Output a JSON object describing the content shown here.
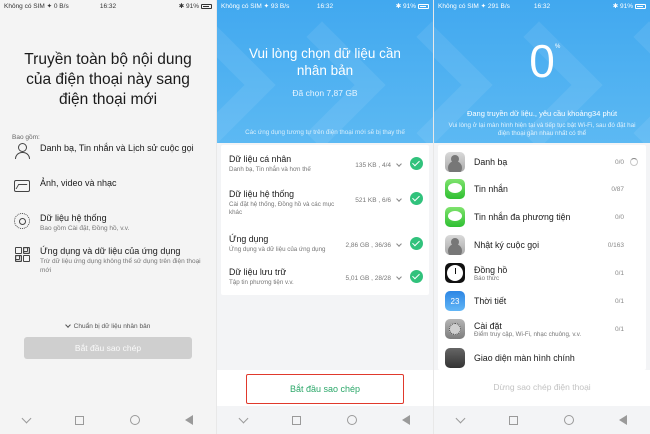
{
  "screen1": {
    "status": {
      "left": "Không có SIM ✦ 0 B/s",
      "time": "16:32",
      "right": "✱ 91%"
    },
    "title": "Truyền toàn bộ nội dung của điện thoại này sang điện thoại mới",
    "includes_label": "Bao gồm:",
    "options": [
      {
        "icon": "person-icon",
        "label": "Danh bạ, Tin nhắn và Lịch sử cuộc gọi",
        "sub": ""
      },
      {
        "icon": "photo-icon",
        "label": "Ảnh, video và nhạc",
        "sub": ""
      },
      {
        "icon": "gear-icon",
        "label": "Dữ liệu hệ thống",
        "sub": "Bao gồm Cài đặt, Đồng hồ, v.v."
      },
      {
        "icon": "apps-icon",
        "label": "Ứng dụng và dữ liệu của ứng dụng",
        "sub": "Trừ dữ liệu ứng dụng không thể sử dụng trên điện thoại mới"
      }
    ],
    "prepare_label": "Chuẩn bị dữ liệu nhân bản",
    "start_button": "Bắt đầu sao chép"
  },
  "screen2": {
    "status": {
      "left": "Không có SIM ✦ 93 B/s",
      "time": "16:32",
      "right": "✱ 91%"
    },
    "title": "Vui lòng chọn dữ liệu cần nhân bản",
    "selected": "Đã chọn 7,87 GB",
    "note": "Các ứng dụng tương tự trên điện thoại mới sẽ bị thay thế",
    "items": [
      {
        "name": "Dữ liệu cá nhân",
        "desc": "Danh bạ, Tin nhắn và hơn thế",
        "size": "135 KB , 4/4"
      },
      {
        "name": "Dữ liệu hệ thống",
        "desc": "Cài đặt hệ thống, Đồng hồ và các mục khác",
        "size": "521 KB , 6/6"
      },
      {
        "name": "Ứng dụng",
        "desc": "Ứng dụng và dữ liệu của ứng dụng",
        "size": "2,86 GB , 36/36"
      },
      {
        "name": "Dữ liệu lưu trữ",
        "desc": "Tập tin phương tiện v.v.",
        "size": "5,01 GB , 28/28"
      }
    ],
    "start_button": "Bắt đầu sao chép"
  },
  "screen3": {
    "status": {
      "left": "Không có SIM ✦ 291 B/s",
      "time": "16:32",
      "right": "✱ 91%"
    },
    "progress_value": "0",
    "progress_unit": "%",
    "message": "Đang truyền dữ liệu., yêu cầu khoảng34 phút",
    "note": "Vui lòng ở lại màn hình hiện tại và tiếp tục bật Wi-Fi, sau đó đặt hai điện thoại gần nhau nhất có thể",
    "items": [
      {
        "icon": "contacts-icon",
        "name": "Danh bạ",
        "desc": "",
        "count": "0/0"
      },
      {
        "icon": "messages-icon",
        "name": "Tin nhắn",
        "desc": "",
        "count": "0/87"
      },
      {
        "icon": "mms-icon",
        "name": "Tin nhắn đa phương tiện",
        "desc": "",
        "count": "0/0"
      },
      {
        "icon": "call-log-icon",
        "name": "Nhật ký cuộc gọi",
        "desc": "",
        "count": "0/163"
      },
      {
        "icon": "clock-icon",
        "name": "Đồng hồ",
        "desc": "Báo thức",
        "count": "0/1"
      },
      {
        "icon": "weather-icon",
        "name": "Thời tiết",
        "desc": "",
        "count": "0/1"
      },
      {
        "icon": "settings-icon",
        "name": "Cài đặt",
        "desc": "Điểm truy cập, Wi-Fi, nhạc chuông, v.v.",
        "count": "0/1"
      },
      {
        "icon": "home-screen-icon",
        "name": "Giao diện màn hình chính",
        "desc": "",
        "count": ""
      }
    ],
    "weather_glyph": "23",
    "stop_button": "Dừng sao chép điện thoại"
  },
  "colors": {
    "header_blue": "#41a8ef",
    "check_green": "#31c27c",
    "start_text_green": "#2ca86a",
    "highlight_red": "#e0392c"
  }
}
